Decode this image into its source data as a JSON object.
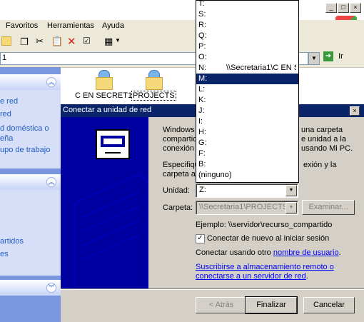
{
  "explorer": {
    "menu": [
      "Favoritos",
      "Herramientas",
      "Ayuda"
    ],
    "address_value": "1",
    "go_label": "Ir",
    "left_pane": {
      "group1_items": [
        "e red",
        "red",
        "d doméstica o",
        "eña",
        "upo de trabajo"
      ],
      "group2_items": [
        "artidos",
        "es"
      ]
    },
    "folders": [
      {
        "label": "C EN SECRET1",
        "selected": false
      },
      {
        "label": "PROJECTS",
        "selected": true
      }
    ]
  },
  "dialog": {
    "title": "Conectar a unidad de red",
    "close": "×",
    "intro_lines": [
      "Windows",
      "compartid",
      "conexión"
    ],
    "intro_right_lines": [
      "una carpeta",
      "e unidad a la",
      "usando Mi PC."
    ],
    "instr_lines": [
      "Especifiqu",
      "carpeta a"
    ],
    "instr_right_lines": [
      "exión y la"
    ],
    "unidad_label": "Unidad:",
    "unidad_value": "Z:",
    "carpeta_label": "Carpeta:",
    "carpeta_value": "\\\\Secretaria1\\PROJECTS",
    "examinar_label": "Examinar...",
    "ejemplo": "Ejemplo: \\\\servidor\\recurso_compartido",
    "reconnect_label": "Conectar de nuevo al iniciar sesión",
    "reconnect_checked": "✓",
    "other_user_prefix": "Conectar usando otro ",
    "other_user_link": "nombre de usuario",
    "other_user_suffix": ".",
    "storage_link_line1": "Suscribirse a almacenamiento remoto o",
    "storage_link_line2": "conectarse a un servidor de red",
    "storage_suffix": ".",
    "back_label": "< Atrás",
    "finish_label": "Finalizar",
    "cancel_label": "Cancelar"
  },
  "drive_list": [
    {
      "letter": "T:",
      "path": ""
    },
    {
      "letter": "S:",
      "path": ""
    },
    {
      "letter": "R:",
      "path": ""
    },
    {
      "letter": "Q:",
      "path": ""
    },
    {
      "letter": "P:",
      "path": ""
    },
    {
      "letter": "O:",
      "path": ""
    },
    {
      "letter": "N:",
      "path": "\\\\Secretaria1\\C EN SECRET"
    },
    {
      "letter": "M:",
      "path": "",
      "selected": true
    },
    {
      "letter": "L:",
      "path": ""
    },
    {
      "letter": "K:",
      "path": ""
    },
    {
      "letter": "J:",
      "path": ""
    },
    {
      "letter": "I:",
      "path": ""
    },
    {
      "letter": "H:",
      "path": ""
    },
    {
      "letter": "G:",
      "path": ""
    },
    {
      "letter": "F:",
      "path": ""
    },
    {
      "letter": "B:",
      "path": ""
    },
    {
      "letter": "(ninguno)",
      "path": ""
    }
  ],
  "colors": {
    "dialog_title": "#0a246a",
    "wizard_art": "#0000a0",
    "link": "#0000ff",
    "task_pane": "#7a96df"
  }
}
